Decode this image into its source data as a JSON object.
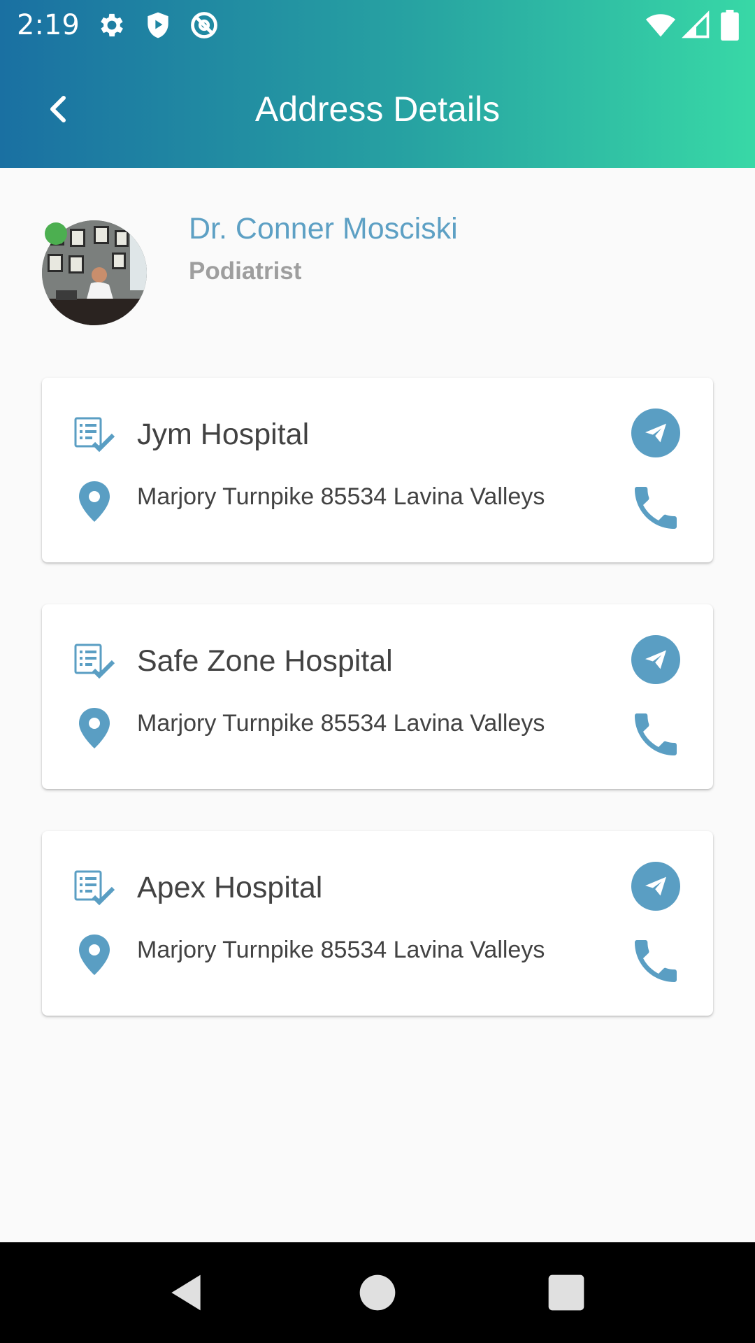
{
  "status_bar": {
    "time": "2:19",
    "icons": [
      "settings-icon",
      "shield-play-icon",
      "at-sign-icon",
      "wifi-icon",
      "signal-icon",
      "battery-icon"
    ]
  },
  "app_bar": {
    "title": "Address Details",
    "back_icon": "chevron-left-icon"
  },
  "doctor": {
    "name": "Dr. Conner Mosciski",
    "specialty": "Podiatrist",
    "online": true,
    "online_color": "#4caf50"
  },
  "hospitals": [
    {
      "name": "Jym Hospital",
      "address": "Marjory Turnpike 85534 Lavina Valleys"
    },
    {
      "name": "Safe Zone Hospital",
      "address": "Marjory Turnpike 85534 Lavina Valleys"
    },
    {
      "name": "Apex Hospital",
      "address": "Marjory Turnpike 85534 Lavina Valleys"
    }
  ],
  "colors": {
    "accent": "#5a9ec3",
    "name_text": "#5da0c4",
    "gradient_start": "#1a70a2",
    "gradient_end": "#38d8a6"
  },
  "nav_bar": {
    "buttons": [
      "back-triangle-icon",
      "home-circle-icon",
      "recents-square-icon"
    ]
  }
}
